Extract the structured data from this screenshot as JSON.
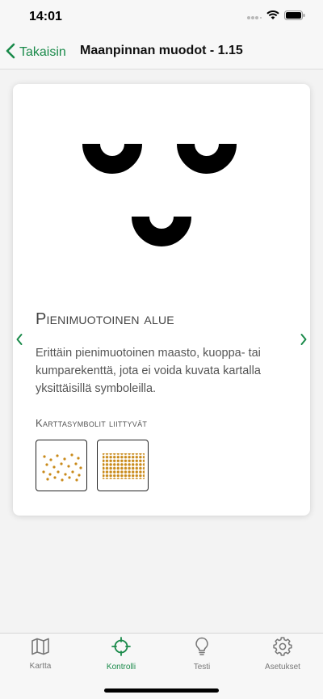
{
  "status_bar": {
    "time": "14:01"
  },
  "nav": {
    "back_label": "Takaisin",
    "title": "Maanpinnan muodot - 1.15"
  },
  "card": {
    "title": "Pienimuotoinen alue",
    "description": "Erittäin pienimuotoinen maasto, kuoppa- tai kumparekenttä, jota ei voida kuvata kartalla yksittäisillä symboleilla.",
    "related_label": "Karttasymbolit liittyvät",
    "related_symbols": [
      {
        "icon": "sparse-dots-symbol"
      },
      {
        "icon": "dense-dots-symbol"
      }
    ]
  },
  "tabs": [
    {
      "label": "Kartta",
      "icon": "map-icon",
      "active": false
    },
    {
      "label": "Kontrolli",
      "icon": "crosshair-icon",
      "active": true
    },
    {
      "label": "Testi",
      "icon": "lightbulb-icon",
      "active": false
    },
    {
      "label": "Asetukset",
      "icon": "gear-icon",
      "active": false
    }
  ],
  "colors": {
    "accent": "#1a8a4a",
    "symbol_black": "#000000",
    "dot_brown": "#c98a1a"
  }
}
